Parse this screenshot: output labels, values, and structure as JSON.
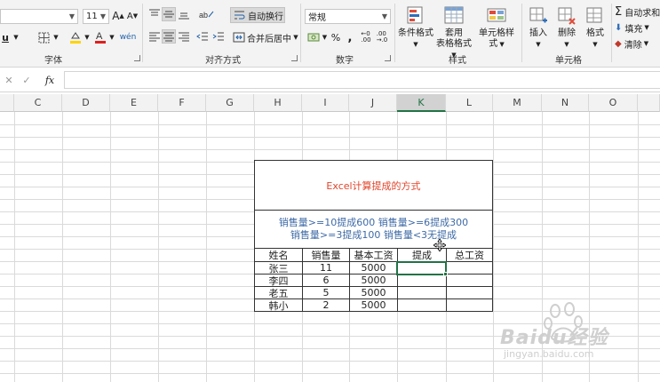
{
  "font": {
    "name": "",
    "size": "11"
  },
  "alignment": {
    "wrap_text": "自动换行",
    "merge_center": "合并后居中"
  },
  "number": {
    "format": "常规"
  },
  "styles": {
    "conditional": "条件格式",
    "table_fmt_1": "套用",
    "table_fmt_2": "表格格式",
    "cell_styles": "单元格样式"
  },
  "cells_group": {
    "insert": "插入",
    "delete": "删除",
    "format": "格式"
  },
  "editing": {
    "autosum": "自动求和",
    "fill": "填充",
    "clear": "清除"
  },
  "group_labels": {
    "font": "字体",
    "alignment": "对齐方式",
    "number": "数字",
    "styles": "样式",
    "cells": "单元格"
  },
  "formula_bar": {
    "fx": "fx",
    "value": ""
  },
  "columns": [
    "C",
    "D",
    "E",
    "F",
    "G",
    "H",
    "I",
    "J",
    "K",
    "L",
    "M",
    "N",
    "O"
  ],
  "selected_column": "K",
  "sheet": {
    "title": "Excel计算提成的方式",
    "rule_line1": "销售量>=10提成600  销售量>=6提成300",
    "rule_line2": "销售量>=3提成100  销售量<3无提成",
    "headers": [
      "姓名",
      "销售量",
      "基本工资",
      "提成",
      "总工资"
    ],
    "rows": [
      [
        "张三",
        "11",
        "5000",
        "",
        ""
      ],
      [
        "李四",
        "6",
        "5000",
        "",
        ""
      ],
      [
        "老五",
        "5",
        "5000",
        "",
        ""
      ],
      [
        "韩小",
        "2",
        "5000",
        "",
        ""
      ]
    ]
  },
  "watermark": {
    "brand": "Baidu经验",
    "url": "jingyan.baidu.com"
  },
  "colors": {
    "excel_green": "#217346",
    "title_red": "#e0452b",
    "rule_blue": "#3e6aa6"
  }
}
